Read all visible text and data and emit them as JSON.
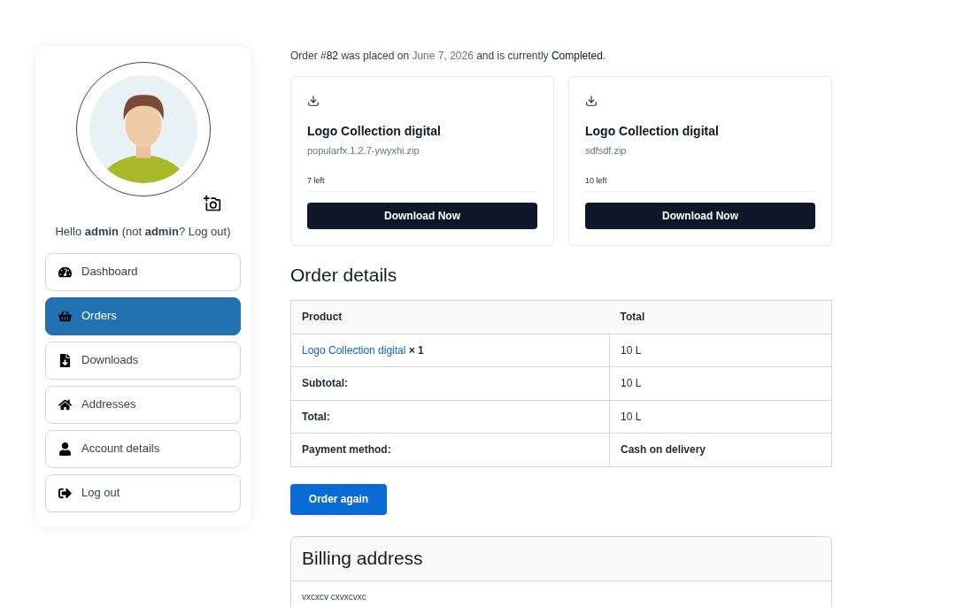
{
  "sidebar": {
    "greeting": {
      "before": "Hello **admin** (not **admin**? ",
      "link": "Log out",
      "after": ")"
    },
    "items": [
      {
        "label": "Dashboard",
        "kind": "dashboard",
        "selected": false
      },
      {
        "label": "Orders",
        "kind": "orders",
        "selected": true
      },
      {
        "label": "Downloads",
        "kind": "downloads",
        "selected": false
      },
      {
        "label": "Addresses",
        "kind": "addresses",
        "selected": false
      },
      {
        "label": "Account details",
        "kind": "account",
        "selected": false
      },
      {
        "label": "Log out",
        "kind": "logout",
        "selected": false
      }
    ]
  },
  "order_status": [
    {
      "kind": "plain",
      "text": "Order #"
    },
    {
      "kind": "mark",
      "text": "82"
    },
    {
      "kind": "plain",
      "text": " was placed on "
    },
    {
      "kind": "date",
      "text": "June 7, 2026"
    },
    {
      "kind": "plain",
      "text": " and is currently "
    },
    {
      "kind": "mark",
      "text": "Completed"
    },
    {
      "kind": "plain",
      "text": "."
    }
  ],
  "downloads": [
    {
      "title": "Logo Collection digital",
      "file": "popularfx.1.2.7-ywyxhi.zip",
      "remaining": "7 left",
      "button": "Download Now"
    },
    {
      "title": "Logo Collection digital",
      "file": "sdfsdf.zip",
      "remaining": "10 left",
      "button": "Download Now"
    }
  ],
  "order_details": {
    "title": "Order details",
    "columns": [
      "Product",
      "Total"
    ],
    "rows": [
      {
        "kind": "product",
        "label": "Logo Collection digital",
        "qty": "× 1",
        "value": "10 L"
      },
      {
        "kind": "total",
        "label": "Subtotal:",
        "value": "10 L"
      },
      {
        "kind": "total",
        "label": "Total:",
        "value": "10 L"
      },
      {
        "kind": "total",
        "label": "Payment method:",
        "value": "Cash on delivery"
      }
    ]
  },
  "order_again": "Order again",
  "billing": {
    "title": "Billing address",
    "lines": [
      "vxcxcv cxvxcvxc"
    ]
  }
}
